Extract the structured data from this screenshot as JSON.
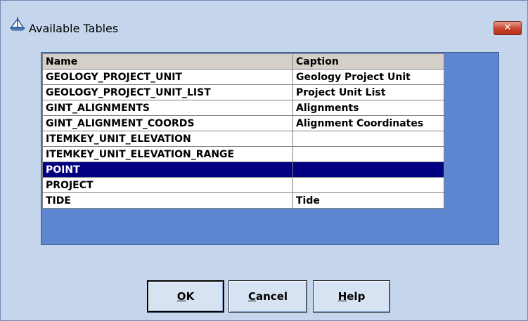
{
  "window": {
    "title": "Available Tables",
    "close_label": "✕"
  },
  "grid": {
    "columns": [
      "Name",
      "Caption"
    ],
    "rows": [
      {
        "name": "GEOLOGY_PROJECT_UNIT",
        "caption": "Geology Project Unit"
      },
      {
        "name": "GEOLOGY_PROJECT_UNIT_LIST",
        "caption": "Project Unit List"
      },
      {
        "name": "GINT_ALIGNMENTS",
        "caption": "Alignments"
      },
      {
        "name": "GINT_ALIGNMENT_COORDS",
        "caption": "Alignment Coordinates"
      },
      {
        "name": "ITEMKEY_UNIT_ELEVATION",
        "caption": ""
      },
      {
        "name": "ITEMKEY_UNIT_ELEVATION_RANGE",
        "caption": ""
      },
      {
        "name": "POINT",
        "caption": ""
      },
      {
        "name": "PROJECT",
        "caption": ""
      },
      {
        "name": "TIDE",
        "caption": "Tide"
      }
    ],
    "selected_row": "POINT"
  },
  "buttons": {
    "ok": {
      "mnemonic": "O",
      "rest": "K"
    },
    "cancel": {
      "mnemonic": "C",
      "rest": "ancel"
    },
    "help": {
      "mnemonic": "H",
      "rest": "elp"
    }
  },
  "colors": {
    "window_bg": "#c5d6ec",
    "grid_bg": "#5f86d1",
    "selection": "#000080",
    "close_button": "#c7432a"
  }
}
